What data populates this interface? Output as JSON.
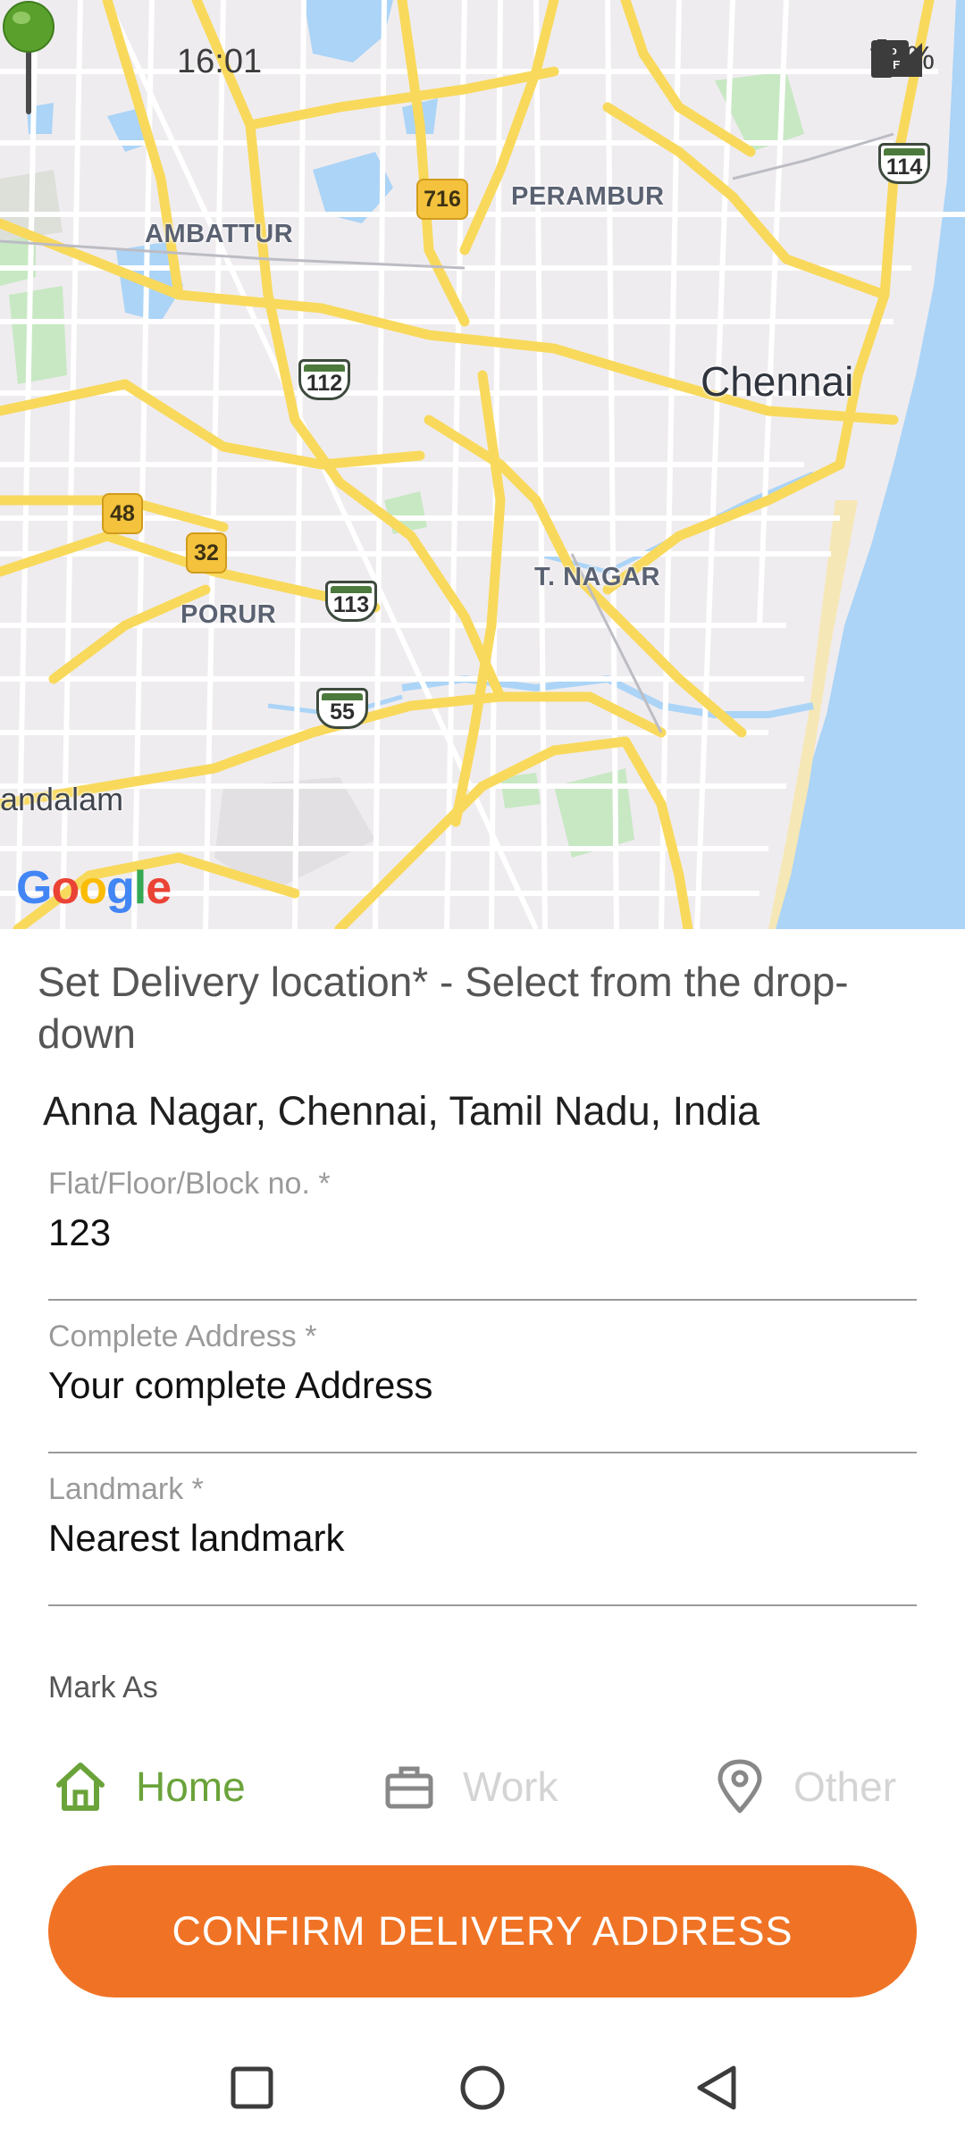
{
  "status_bar": {
    "time": "16:01",
    "network_icons": [
      "volte-icon",
      "4g-signal-icon"
    ],
    "battery_percent": "69%"
  },
  "map": {
    "labels": {
      "perambur": "PERAMBUR",
      "ambattur": "AMBATTUR",
      "chennai": "Chennai",
      "t_nagar": "T. NAGAR",
      "porur": "PORUR",
      "andalam": "andalam"
    },
    "shields": {
      "r716": "716",
      "r114": "114",
      "r112": "112",
      "r48": "48",
      "r32": "32",
      "r113": "113",
      "r55": "55"
    },
    "attribution": "Google",
    "pin_color": "#5aa02c"
  },
  "form": {
    "title": "Set Delivery location* - Select from the drop-down",
    "selected_address": "Anna Nagar, Chennai, Tamil Nadu, India",
    "flat": {
      "label": "Flat/Floor/Block no. *",
      "value": "123"
    },
    "complete_address": {
      "label": "Complete Address *",
      "placeholder": "Your complete Address"
    },
    "landmark": {
      "label": "Landmark *",
      "placeholder": "Nearest landmark"
    },
    "mark_as_label": "Mark As",
    "tags": [
      {
        "label": "Home",
        "icon": "home-icon",
        "selected": true
      },
      {
        "label": "Work",
        "icon": "briefcase-icon",
        "selected": false
      },
      {
        "label": "Other",
        "icon": "location-pin-icon",
        "selected": false
      }
    ],
    "confirm_label": "CONFIRM DELIVERY ADDRESS"
  },
  "colors": {
    "accent_orange": "#f07325",
    "selected_green": "#6aa33a",
    "water": "#abd4f7",
    "road": "#f8d95c"
  }
}
